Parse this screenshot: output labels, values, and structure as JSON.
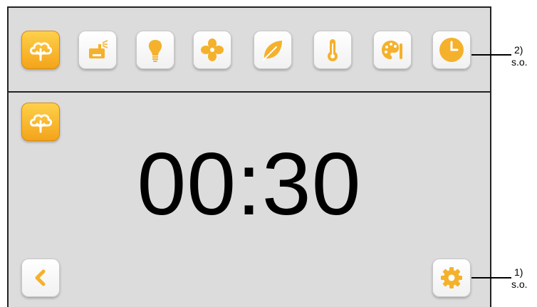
{
  "toolbar": {
    "icons": [
      "steam-cloud-icon",
      "steam-generator-icon",
      "light-bulb-icon",
      "fan-icon",
      "leaf-icon",
      "thermometer-icon",
      "palette-icon",
      "clock-icon"
    ],
    "active_index": 0
  },
  "main": {
    "mode_icon": "steam-cloud-icon",
    "timer": "00:30",
    "back_icon": "chevron-left-icon",
    "settings_icon": "gear-icon"
  },
  "callouts": {
    "top": {
      "number": "2)",
      "text": "s.o."
    },
    "bottom": {
      "number": "1)",
      "text": "s.o."
    }
  },
  "colors": {
    "accent": "#f5b12b",
    "background": "#dcdcdc",
    "divider": "#222222"
  }
}
